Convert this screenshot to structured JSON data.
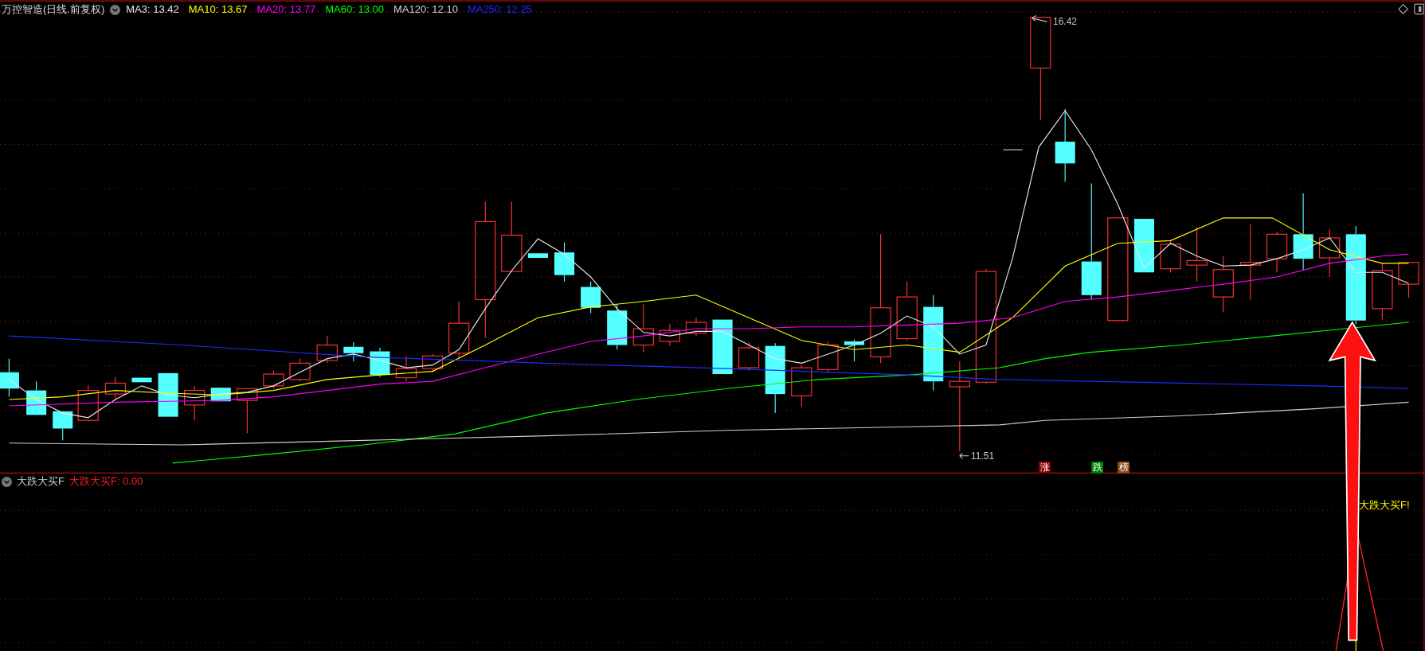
{
  "chart_header": {
    "title": "万控智造(日线.前复权)",
    "indicators": [
      {
        "label": "MA3: 13.42",
        "color": "#e8e8e8"
      },
      {
        "label": "MA10: 13.67",
        "color": "#ffff00"
      },
      {
        "label": "MA20: 13.77",
        "color": "#ff00ff"
      },
      {
        "label": "MA60: 13.00",
        "color": "#00ff00"
      },
      {
        "label": "MA120: 12.10",
        "color": "#d0d0d0"
      },
      {
        "label": "MA250: 12.25",
        "color": "#1c2cff"
      }
    ]
  },
  "price_labels": {
    "high": "16.42",
    "low": "11.51"
  },
  "badges": [
    {
      "text": "涨",
      "color": "#8b0000"
    },
    {
      "text": "跌",
      "color": "#007a00"
    },
    {
      "text": "榜",
      "color": "#8b4a14"
    }
  ],
  "indicator_panel": {
    "name": "大跌大买F",
    "value": "大跌大买F: 0.00",
    "signal_label": "大跌大买F!"
  }
}
